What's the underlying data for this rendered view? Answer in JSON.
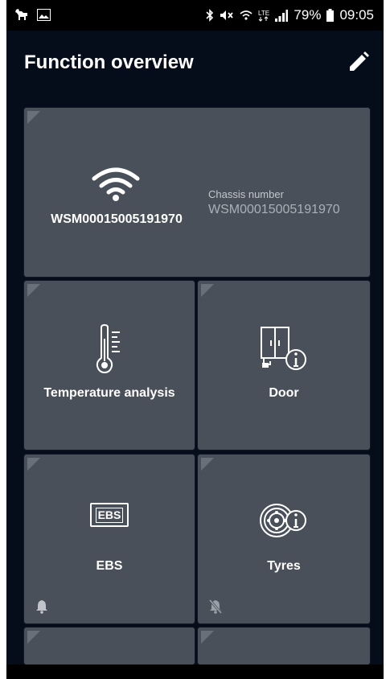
{
  "status_bar": {
    "battery": "79%",
    "time": "09:05",
    "icons": [
      "deer-icon",
      "image-icon",
      "bluetooth-icon",
      "mute-icon",
      "wifi-icon",
      "lte-icon",
      "signal-icon",
      "battery-icon"
    ]
  },
  "header": {
    "title": "Function overview",
    "edit_icon": "pencil-icon"
  },
  "tiles": {
    "vehicle": {
      "name": "WSM00015005191970",
      "chassis_label": "Chassis number",
      "chassis_value": "WSM00015005191970",
      "icon": "wifi-icon"
    },
    "temperature": {
      "label": "Temperature analysis",
      "icon": "thermometer-icon"
    },
    "door": {
      "label": "Door",
      "icon": "door-info-icon"
    },
    "ebs": {
      "label": "EBS",
      "badge": "EBS",
      "icon": "ebs-icon",
      "alert_icon": "bell-icon"
    },
    "tyres": {
      "label": "Tyres",
      "icon": "tyre-info-icon",
      "alert_icon": "bell-off-icon"
    }
  },
  "colors": {
    "background": "#050c1a",
    "tile": "#4a5059",
    "text": "#ffffff",
    "muted_text": "#aab0b8"
  }
}
